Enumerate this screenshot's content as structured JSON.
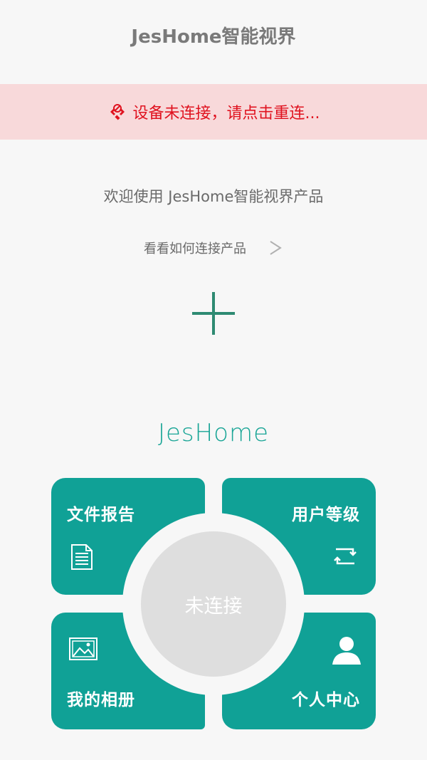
{
  "header": {
    "title": "JesHome智能视界"
  },
  "alert": {
    "text": "设备未连接，请点击重连...",
    "color": "#e0121f",
    "background": "#f8d9da"
  },
  "main": {
    "welcome": "欢迎使用 JesHome智能视界产品",
    "how_to_link": "看看如何连接产品",
    "add_icon": "plus-icon"
  },
  "brand": {
    "logo_text": "JesHome",
    "accent": "#10a196"
  },
  "tiles": {
    "file_report": {
      "label": "文件报告",
      "icon": "document-icon"
    },
    "user_level": {
      "label": "用户等级",
      "icon": "refresh-icon"
    },
    "my_album": {
      "label": "我的相册",
      "icon": "image-icon"
    },
    "profile": {
      "label": "个人中心",
      "icon": "user-icon"
    }
  },
  "center": {
    "status": "未连接"
  }
}
